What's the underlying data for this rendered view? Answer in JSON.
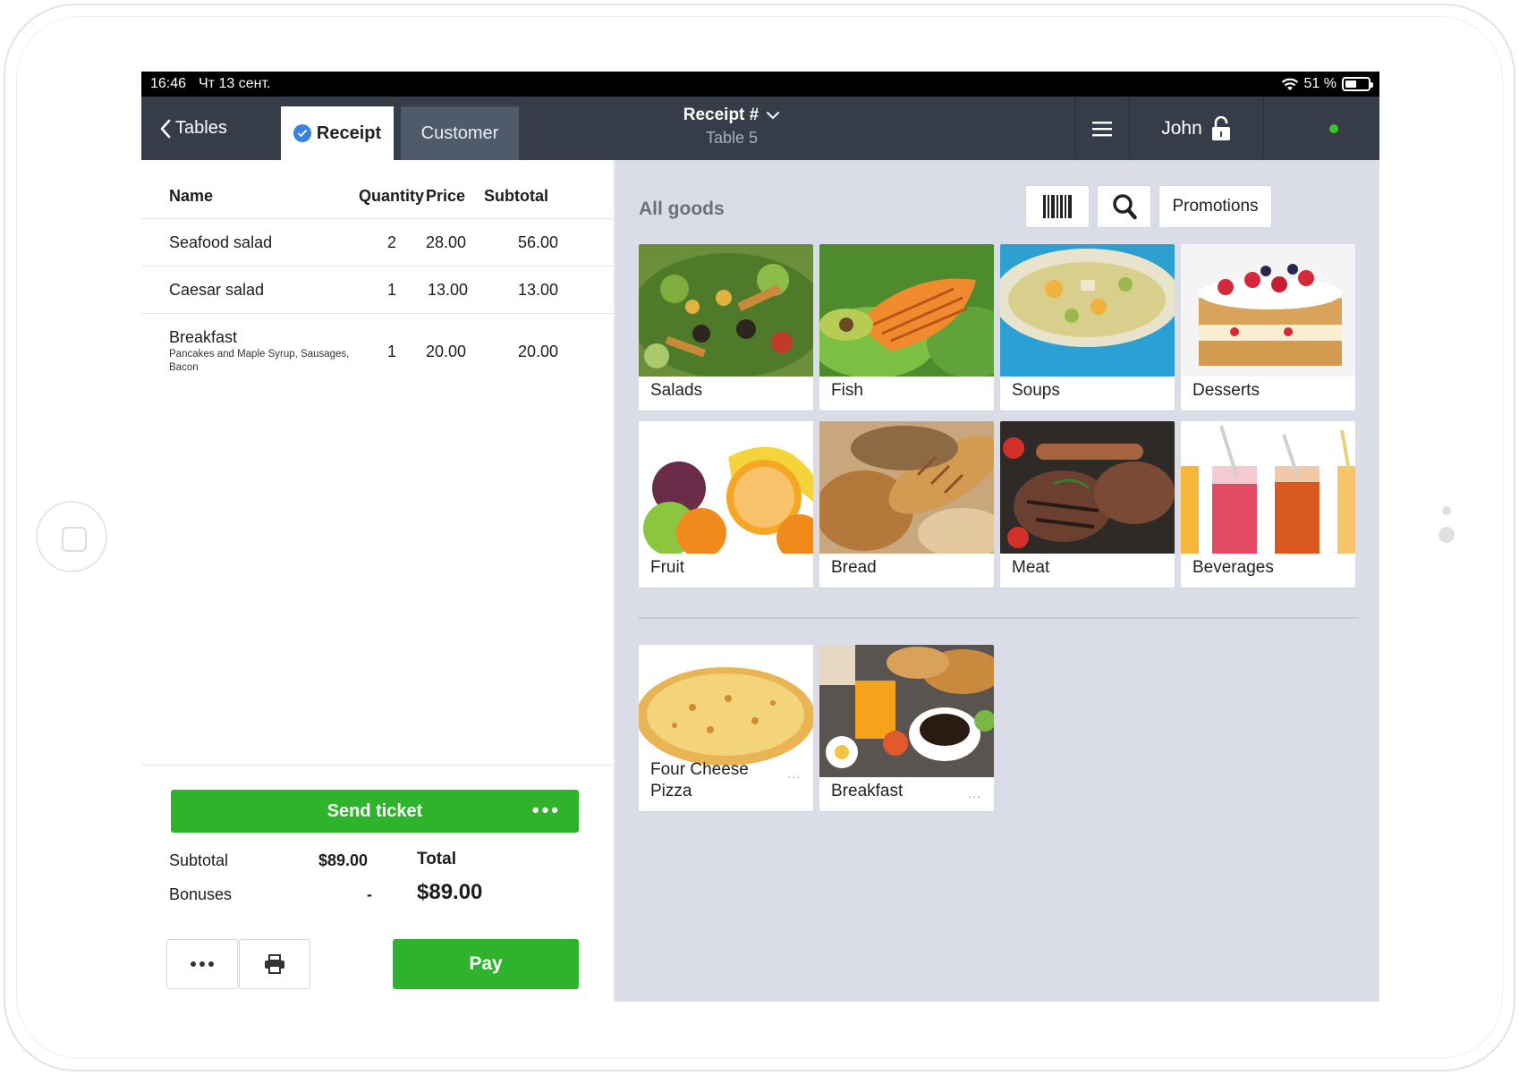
{
  "status_bar": {
    "time": "16:46",
    "date": "Чт 13 сент.",
    "battery": "51 %",
    "battery_level": 0.51
  },
  "header": {
    "back_label": "Tables",
    "tabs": [
      {
        "label": "Receipt",
        "active": true
      },
      {
        "label": "Customer",
        "active": false
      }
    ],
    "receipt_title": "Receipt #",
    "table_label": "Table 5",
    "user_name": "John",
    "online_color": "#3ac62e"
  },
  "receipt": {
    "columns": {
      "name": "Name",
      "quantity": "Quantity",
      "price": "Price",
      "subtotal": "Subtotal"
    },
    "items": [
      {
        "name": "Seafood salad",
        "modifiers": "",
        "quantity": "2",
        "price": "28.00",
        "subtotal": "56.00"
      },
      {
        "name": "Caesar salad",
        "modifiers": "",
        "quantity": "1",
        "price": "13.00",
        "subtotal": "13.00"
      },
      {
        "name": "Breakfast",
        "modifiers": "Pancakes and Maple Syrup, Sausages, Bacon",
        "quantity": "1",
        "price": "20.00",
        "subtotal": "20.00"
      }
    ],
    "send_ticket_label": "Send ticket",
    "subtotal_label": "Subtotal",
    "subtotal_value": "$89.00",
    "bonuses_label": "Bonuses",
    "bonuses_value": "-",
    "total_label": "Total",
    "total_value": "$89.00",
    "pay_label": "Pay"
  },
  "goods": {
    "title": "All goods",
    "promotions_label": "Promotions",
    "categories": [
      {
        "label": "Salads",
        "icon": "salad-image"
      },
      {
        "label": "Fish",
        "icon": "fish-image"
      },
      {
        "label": "Soups",
        "icon": "soup-image"
      },
      {
        "label": "Desserts",
        "icon": "dessert-image"
      },
      {
        "label": "Fruit",
        "icon": "fruit-image"
      },
      {
        "label": "Bread",
        "icon": "bread-image"
      },
      {
        "label": "Meat",
        "icon": "meat-image"
      },
      {
        "label": "Beverages",
        "icon": "beverages-image"
      }
    ],
    "products": [
      {
        "label": "Four Cheese Pizza",
        "line1": "Four Cheese",
        "line2": "Pizza",
        "more": "...",
        "icon": "pizza-image"
      },
      {
        "label": "Breakfast",
        "more": "...",
        "icon": "breakfast-image"
      }
    ]
  },
  "colors": {
    "accent_green": "#2fb32c",
    "header_bg": "#363c48",
    "goods_bg": "#dadde8",
    "check_blue": "#3b82e0"
  }
}
